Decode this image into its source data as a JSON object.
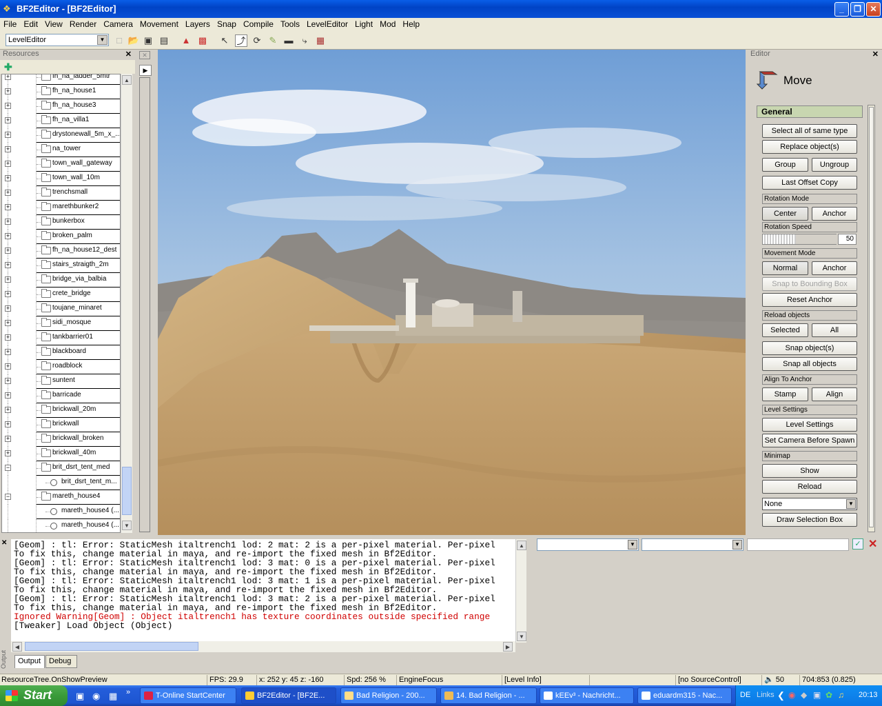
{
  "window": {
    "title": "BF2Editor - [BF2Editor]"
  },
  "menu": [
    "File",
    "Edit",
    "View",
    "Render",
    "Camera",
    "Movement",
    "Layers",
    "Snap",
    "Compile",
    "Tools",
    "LevelEditor",
    "Light",
    "Mod",
    "Help"
  ],
  "toolbar": {
    "mode": "LevelEditor"
  },
  "resources": {
    "title": "Resources",
    "items": [
      {
        "label": "fh_na_ladder_5mtr",
        "type": "folder",
        "state": "+"
      },
      {
        "label": "fh_na_house1",
        "type": "folder",
        "state": "+"
      },
      {
        "label": "fh_na_house3",
        "type": "folder",
        "state": "+"
      },
      {
        "label": "fh_na_villa1",
        "type": "folder",
        "state": "+"
      },
      {
        "label": "drystonewall_5m_x_...",
        "type": "folder",
        "state": "+"
      },
      {
        "label": "na_tower",
        "type": "folder",
        "state": "+"
      },
      {
        "label": "town_wall_gateway",
        "type": "folder",
        "state": "+"
      },
      {
        "label": "town_wall_10m",
        "type": "folder",
        "state": "+"
      },
      {
        "label": "trenchsmall",
        "type": "folder",
        "state": "+"
      },
      {
        "label": "marethbunker2",
        "type": "folder",
        "state": "+"
      },
      {
        "label": "bunkerbox",
        "type": "folder",
        "state": "+"
      },
      {
        "label": "broken_palm",
        "type": "folder",
        "state": "+"
      },
      {
        "label": "fh_na_house12_dest",
        "type": "folder",
        "state": "+"
      },
      {
        "label": "stairs_straigth_2m",
        "type": "folder",
        "state": "+"
      },
      {
        "label": "bridge_via_balbia",
        "type": "folder",
        "state": "+"
      },
      {
        "label": "crete_bridge",
        "type": "folder",
        "state": "+"
      },
      {
        "label": "toujane_minaret",
        "type": "folder",
        "state": "+"
      },
      {
        "label": "sidi_mosque",
        "type": "folder",
        "state": "+"
      },
      {
        "label": "tankbarrier01",
        "type": "folder",
        "state": "+"
      },
      {
        "label": "blackboard",
        "type": "folder",
        "state": "+"
      },
      {
        "label": "roadblock",
        "type": "folder",
        "state": "+"
      },
      {
        "label": "suntent",
        "type": "folder",
        "state": "+"
      },
      {
        "label": "barricade",
        "type": "folder",
        "state": "+"
      },
      {
        "label": "brickwall_20m",
        "type": "folder",
        "state": "+"
      },
      {
        "label": "brickwall",
        "type": "folder",
        "state": "+"
      },
      {
        "label": "brickwall_broken",
        "type": "folder",
        "state": "+"
      },
      {
        "label": "brickwall_40m",
        "type": "folder",
        "state": "+"
      },
      {
        "label": "brit_dsrt_tent_med",
        "type": "folder",
        "state": "-"
      },
      {
        "label": "brit_dsrt_tent_m...",
        "type": "mesh",
        "state": ""
      },
      {
        "label": "mareth_house4",
        "type": "folder",
        "state": "-"
      },
      {
        "label": "mareth_house4 (...",
        "type": "mesh",
        "state": ""
      },
      {
        "label": "mareth_house4 (...",
        "type": "mesh",
        "state": ""
      }
    ]
  },
  "editor": {
    "title": "Editor",
    "tool": "Move",
    "section": "General",
    "select_all": "Select all of same type",
    "replace": "Replace object(s)",
    "group": "Group",
    "ungroup": "Ungroup",
    "last_offset": "Last Offset Copy",
    "rotation_mode": "Rotation Mode",
    "center": "Center",
    "anchor": "Anchor",
    "rotation_speed": "Rotation Speed",
    "rotation_value": "50",
    "movement_mode": "Movement Mode",
    "normal": "Normal",
    "snap_bbox": "Snap to Bounding Box",
    "reset_anchor": "Reset Anchor",
    "reload_objects": "Reload objects",
    "selected": "Selected",
    "all": "All",
    "snap_objects": "Snap object(s)",
    "snap_all": "Snap all objects",
    "align_to_anchor": "Align To Anchor",
    "stamp": "Stamp",
    "align": "Align",
    "level_settings_lbl": "Level Settings",
    "level_settings": "Level Settings",
    "set_camera": "Set Camera Before Spawn",
    "minimap": "Minimap",
    "show": "Show",
    "reload": "Reload",
    "none": "None",
    "draw_sel": "Draw Selection Box"
  },
  "output": {
    "label": "Output",
    "lines": [
      {
        "text": "[Geom] : tl: Error: StaticMesh italtrench1 lod: 2 mat: 2 is a per-pixel material. Per-pixel",
        "color": "normal"
      },
      {
        "text": "To fix this, change material in maya, and re-import the fixed mesh in Bf2Editor.",
        "color": "normal"
      },
      {
        "text": "[Geom] : tl: Error: StaticMesh italtrench1 lod: 3 mat: 0 is a per-pixel material. Per-pixel",
        "color": "normal"
      },
      {
        "text": "To fix this, change material in maya, and re-import the fixed mesh in Bf2Editor.",
        "color": "normal"
      },
      {
        "text": "[Geom] : tl: Error: StaticMesh italtrench1 lod: 3 mat: 1 is a per-pixel material. Per-pixel",
        "color": "normal"
      },
      {
        "text": "To fix this, change material in maya, and re-import the fixed mesh in Bf2Editor.",
        "color": "normal"
      },
      {
        "text": "[Geom] : tl: Error: StaticMesh italtrench1 lod: 3 mat: 2 is a per-pixel material. Per-pixel",
        "color": "normal"
      },
      {
        "text": "To fix this, change material in maya, and re-import the fixed mesh in Bf2Editor.",
        "color": "normal"
      },
      {
        "text": "Ignored Warning[Geom] : Object italtrench1 has texture coordinates outside specified range",
        "color": "red"
      },
      {
        "text": "[Tweaker] Load Object (Object)",
        "color": "normal"
      }
    ],
    "tab_output": "Output",
    "tab_debug": "Debug"
  },
  "status": {
    "left": "ResourceTree.OnShowPreview",
    "fps": "FPS: 29.9",
    "coords": "x: 252 y: 45 z: -160",
    "spd": "Spd: 256 %",
    "focus": "EngineFocus",
    "level": "[Level Info]",
    "source": "[no SourceControl]",
    "vol": "50",
    "res": "704:853 (0.825)"
  },
  "taskbar": {
    "start": "Start",
    "tasks": [
      {
        "label": "T-Online StartCenter",
        "active": false
      },
      {
        "label": "BF2Editor - [BF2E...",
        "active": true
      },
      {
        "label": "Bad Religion - 200...",
        "active": false
      },
      {
        "label": "14. Bad Religion - ...",
        "active": false
      },
      {
        "label": "kEEv³ - Nachricht...",
        "active": false
      },
      {
        "label": "eduardm315 - Nac...",
        "active": false
      }
    ],
    "lang": "DE",
    "links": "Links",
    "clock": "20:13"
  }
}
